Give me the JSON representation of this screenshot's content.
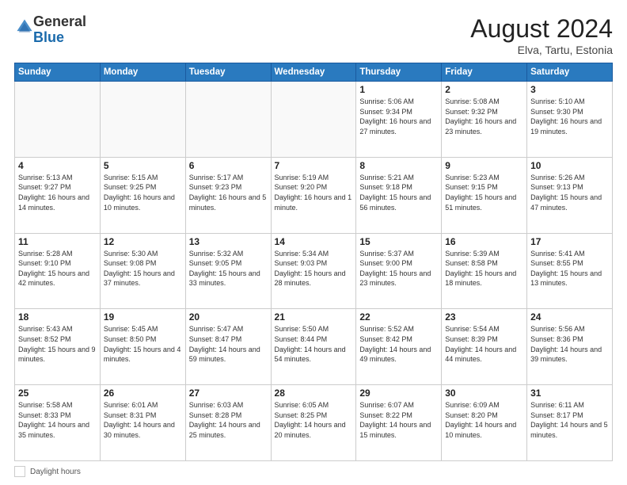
{
  "logo": {
    "general": "General",
    "blue": "Blue"
  },
  "title": {
    "month_year": "August 2024",
    "location": "Elva, Tartu, Estonia"
  },
  "days_of_week": [
    "Sunday",
    "Monday",
    "Tuesday",
    "Wednesday",
    "Thursday",
    "Friday",
    "Saturday"
  ],
  "footer": {
    "label": "Daylight hours"
  },
  "weeks": [
    [
      {
        "day": "",
        "info": ""
      },
      {
        "day": "",
        "info": ""
      },
      {
        "day": "",
        "info": ""
      },
      {
        "day": "",
        "info": ""
      },
      {
        "day": "1",
        "info": "Sunrise: 5:06 AM\nSunset: 9:34 PM\nDaylight: 16 hours\nand 27 minutes."
      },
      {
        "day": "2",
        "info": "Sunrise: 5:08 AM\nSunset: 9:32 PM\nDaylight: 16 hours\nand 23 minutes."
      },
      {
        "day": "3",
        "info": "Sunrise: 5:10 AM\nSunset: 9:30 PM\nDaylight: 16 hours\nand 19 minutes."
      }
    ],
    [
      {
        "day": "4",
        "info": "Sunrise: 5:13 AM\nSunset: 9:27 PM\nDaylight: 16 hours\nand 14 minutes."
      },
      {
        "day": "5",
        "info": "Sunrise: 5:15 AM\nSunset: 9:25 PM\nDaylight: 16 hours\nand 10 minutes."
      },
      {
        "day": "6",
        "info": "Sunrise: 5:17 AM\nSunset: 9:23 PM\nDaylight: 16 hours\nand 5 minutes."
      },
      {
        "day": "7",
        "info": "Sunrise: 5:19 AM\nSunset: 9:20 PM\nDaylight: 16 hours\nand 1 minute."
      },
      {
        "day": "8",
        "info": "Sunrise: 5:21 AM\nSunset: 9:18 PM\nDaylight: 15 hours\nand 56 minutes."
      },
      {
        "day": "9",
        "info": "Sunrise: 5:23 AM\nSunset: 9:15 PM\nDaylight: 15 hours\nand 51 minutes."
      },
      {
        "day": "10",
        "info": "Sunrise: 5:26 AM\nSunset: 9:13 PM\nDaylight: 15 hours\nand 47 minutes."
      }
    ],
    [
      {
        "day": "11",
        "info": "Sunrise: 5:28 AM\nSunset: 9:10 PM\nDaylight: 15 hours\nand 42 minutes."
      },
      {
        "day": "12",
        "info": "Sunrise: 5:30 AM\nSunset: 9:08 PM\nDaylight: 15 hours\nand 37 minutes."
      },
      {
        "day": "13",
        "info": "Sunrise: 5:32 AM\nSunset: 9:05 PM\nDaylight: 15 hours\nand 33 minutes."
      },
      {
        "day": "14",
        "info": "Sunrise: 5:34 AM\nSunset: 9:03 PM\nDaylight: 15 hours\nand 28 minutes."
      },
      {
        "day": "15",
        "info": "Sunrise: 5:37 AM\nSunset: 9:00 PM\nDaylight: 15 hours\nand 23 minutes."
      },
      {
        "day": "16",
        "info": "Sunrise: 5:39 AM\nSunset: 8:58 PM\nDaylight: 15 hours\nand 18 minutes."
      },
      {
        "day": "17",
        "info": "Sunrise: 5:41 AM\nSunset: 8:55 PM\nDaylight: 15 hours\nand 13 minutes."
      }
    ],
    [
      {
        "day": "18",
        "info": "Sunrise: 5:43 AM\nSunset: 8:52 PM\nDaylight: 15 hours\nand 9 minutes."
      },
      {
        "day": "19",
        "info": "Sunrise: 5:45 AM\nSunset: 8:50 PM\nDaylight: 15 hours\nand 4 minutes."
      },
      {
        "day": "20",
        "info": "Sunrise: 5:47 AM\nSunset: 8:47 PM\nDaylight: 14 hours\nand 59 minutes."
      },
      {
        "day": "21",
        "info": "Sunrise: 5:50 AM\nSunset: 8:44 PM\nDaylight: 14 hours\nand 54 minutes."
      },
      {
        "day": "22",
        "info": "Sunrise: 5:52 AM\nSunset: 8:42 PM\nDaylight: 14 hours\nand 49 minutes."
      },
      {
        "day": "23",
        "info": "Sunrise: 5:54 AM\nSunset: 8:39 PM\nDaylight: 14 hours\nand 44 minutes."
      },
      {
        "day": "24",
        "info": "Sunrise: 5:56 AM\nSunset: 8:36 PM\nDaylight: 14 hours\nand 39 minutes."
      }
    ],
    [
      {
        "day": "25",
        "info": "Sunrise: 5:58 AM\nSunset: 8:33 PM\nDaylight: 14 hours\nand 35 minutes."
      },
      {
        "day": "26",
        "info": "Sunrise: 6:01 AM\nSunset: 8:31 PM\nDaylight: 14 hours\nand 30 minutes."
      },
      {
        "day": "27",
        "info": "Sunrise: 6:03 AM\nSunset: 8:28 PM\nDaylight: 14 hours\nand 25 minutes."
      },
      {
        "day": "28",
        "info": "Sunrise: 6:05 AM\nSunset: 8:25 PM\nDaylight: 14 hours\nand 20 minutes."
      },
      {
        "day": "29",
        "info": "Sunrise: 6:07 AM\nSunset: 8:22 PM\nDaylight: 14 hours\nand 15 minutes."
      },
      {
        "day": "30",
        "info": "Sunrise: 6:09 AM\nSunset: 8:20 PM\nDaylight: 14 hours\nand 10 minutes."
      },
      {
        "day": "31",
        "info": "Sunrise: 6:11 AM\nSunset: 8:17 PM\nDaylight: 14 hours\nand 5 minutes."
      }
    ]
  ]
}
